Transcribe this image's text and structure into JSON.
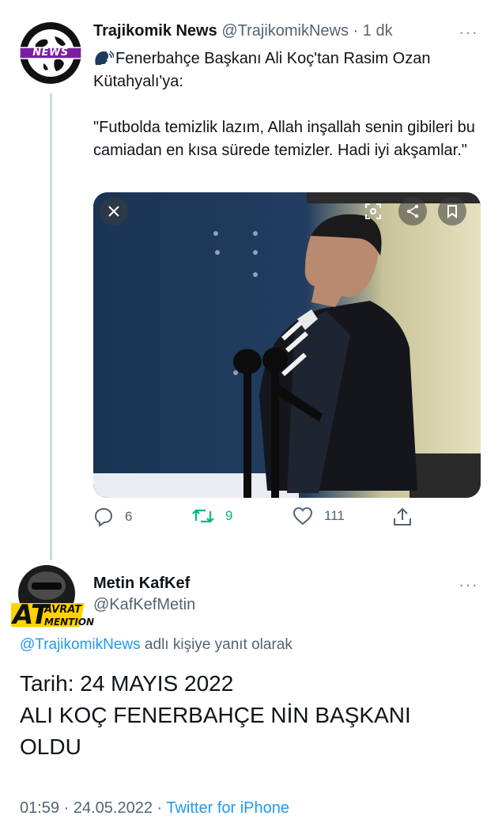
{
  "tweet1": {
    "author_name": "Trajikomik News",
    "author_handle": "@TrajikomikNews",
    "separator": "·",
    "time": "1 dk",
    "more": "···",
    "avatar_badge": "NEWS",
    "emoji_icon": "speaking-head-icon",
    "line1": "Fenerbahçe Başkanı Ali Koç'tan Rasim Ozan Kütahyalı'ya:",
    "line2": "\"Futbolda temizlik lazım, Allah inşallah senin gibileri bu camiadan en kısa sürede temizler. Hadi iyi akşamlar.\"",
    "media_buttons": [
      "close-icon",
      "scan-icon",
      "share-icon",
      "bookmark-icon"
    ],
    "actions": {
      "replies": "6",
      "retweets": "9",
      "likes": "111"
    }
  },
  "tweet2": {
    "author_name": "Metin KafKef",
    "author_handle": "@KafKefMetin",
    "more": "···",
    "avatar_text_1": "AVRAT",
    "avatar_text_2": "AT",
    "avatar_text_3": "MENTION",
    "reply_mention": "@TrajikomikNews",
    "reply_suffix": " adlı kişiye yanıt olarak",
    "body_line1": "Tarih: 24 MAYIS 2022",
    "body_line2": "ALI KOÇ FENERBAHÇE NİN BAŞKANI OLDU",
    "time": "01:59",
    "sep1": " · ",
    "date": "24.05.2022",
    "sep2": " · ",
    "source": "Twitter for iPhone"
  },
  "colors": {
    "link": "#1d9bf0",
    "secondary": "#536471",
    "retweet": "#00ba7c",
    "badge": "#7b1fa2"
  }
}
